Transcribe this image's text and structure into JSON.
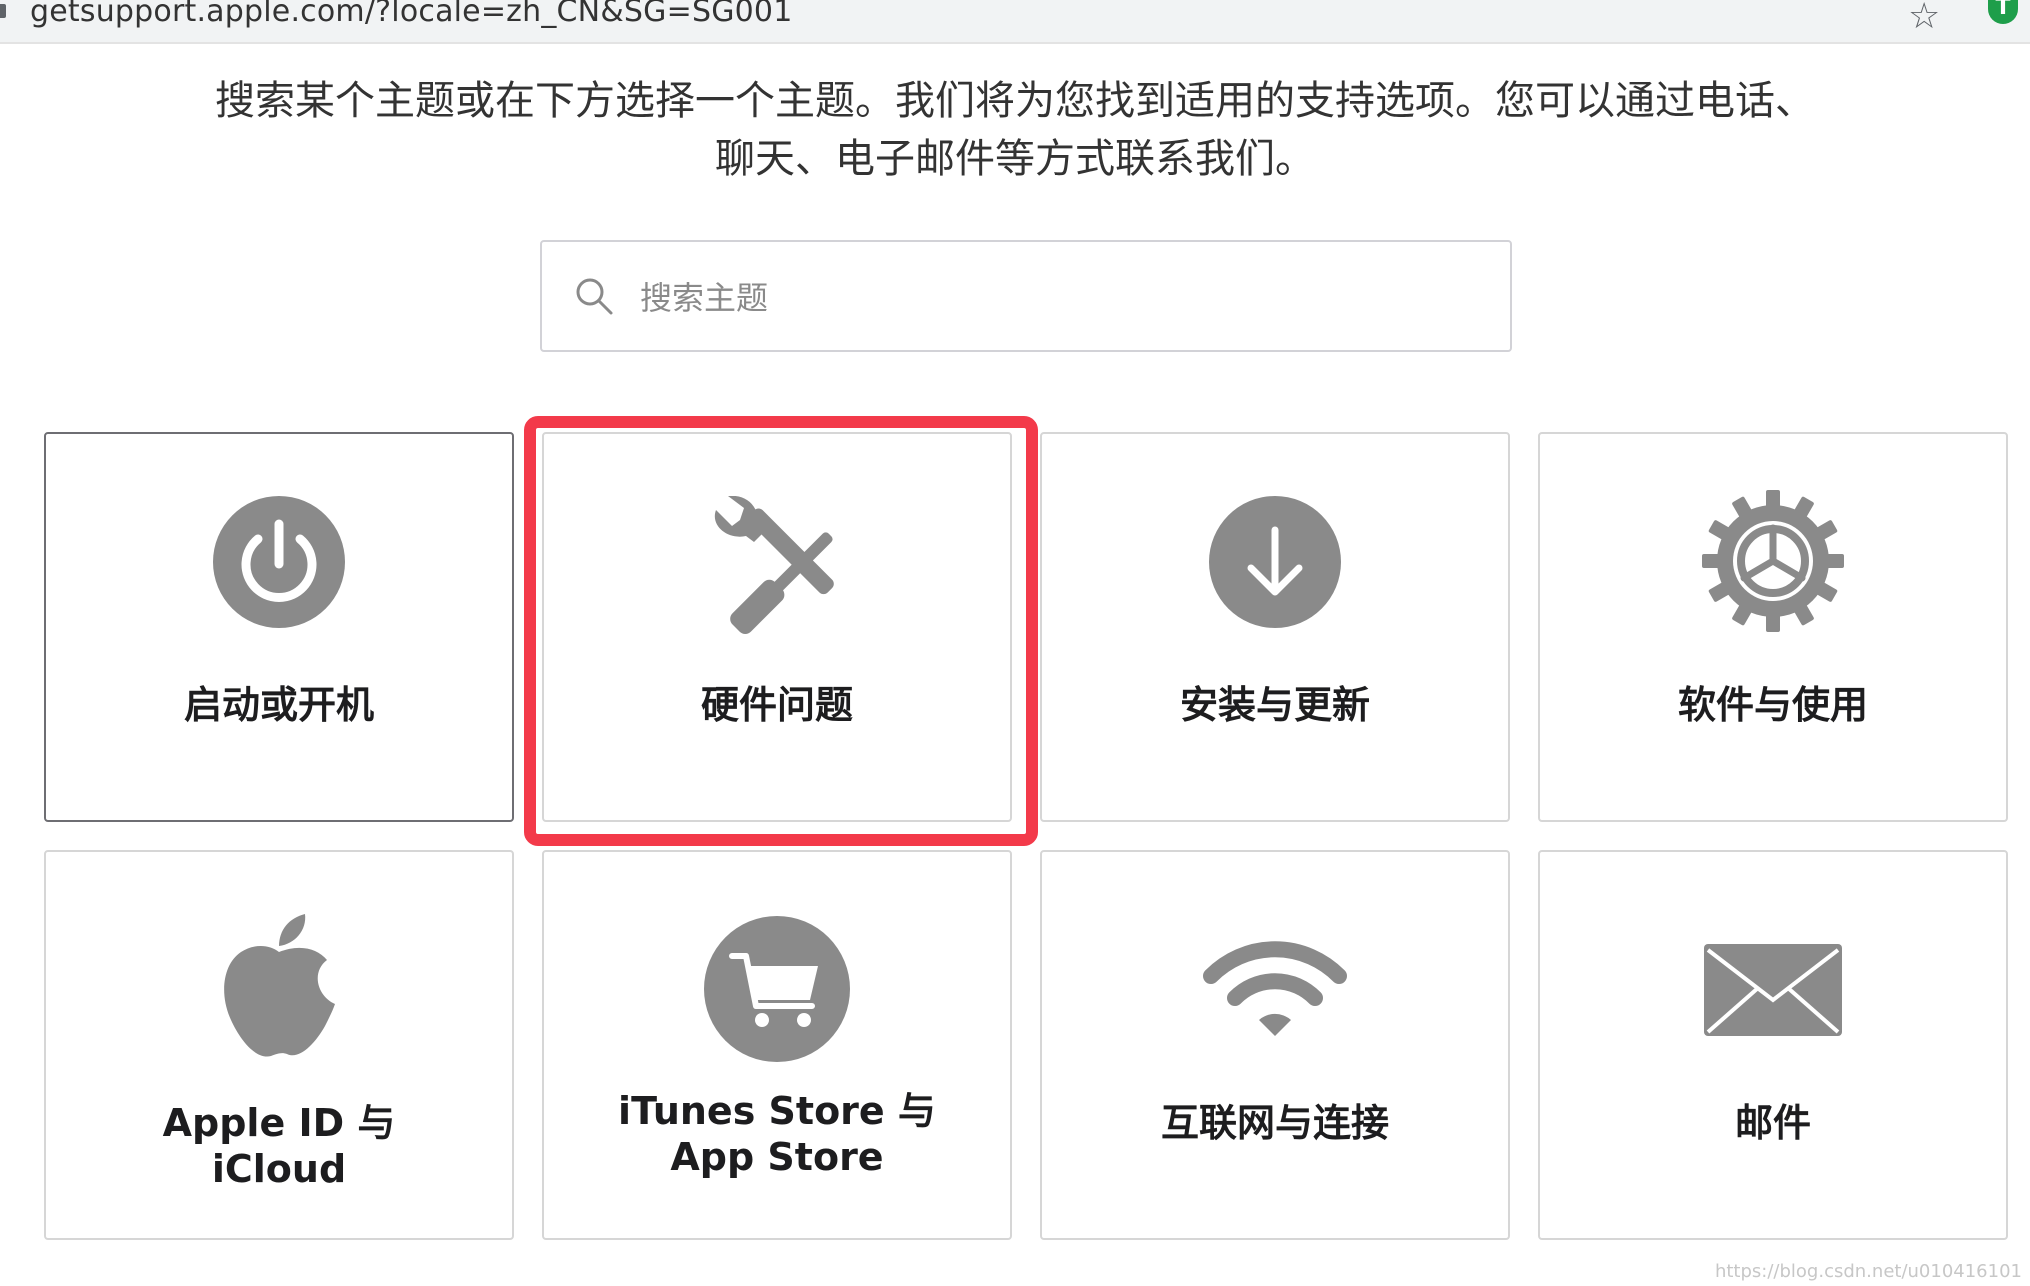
{
  "browser": {
    "url": "getsupport.apple.com/?locale=zh_CN&SG=SG001"
  },
  "intro": "搜索某个主题或在下方选择一个主题。我们将为您找到适用的支持选项。您可以通过电话、聊天、电子邮件等方式联系我们。",
  "search": {
    "placeholder": "搜索主题"
  },
  "tiles": [
    {
      "label": "启动或开机",
      "icon": "power-icon"
    },
    {
      "label": "硬件问题",
      "icon": "tools-icon"
    },
    {
      "label": "安装与更新",
      "icon": "download-icon"
    },
    {
      "label": "软件与使用",
      "icon": "gear-icon"
    },
    {
      "label": "Apple ID 与 iCloud",
      "icon": "apple-icon"
    },
    {
      "label": "iTunes Store 与 App Store",
      "icon": "cart-icon"
    },
    {
      "label": "互联网与连接",
      "icon": "wifi-icon"
    },
    {
      "label": "邮件",
      "icon": "mail-icon"
    }
  ],
  "colors": {
    "icon": "#8a8a8a",
    "highlight": "#f33a4a"
  },
  "watermark": "https://blog.csdn.net/u010416101"
}
